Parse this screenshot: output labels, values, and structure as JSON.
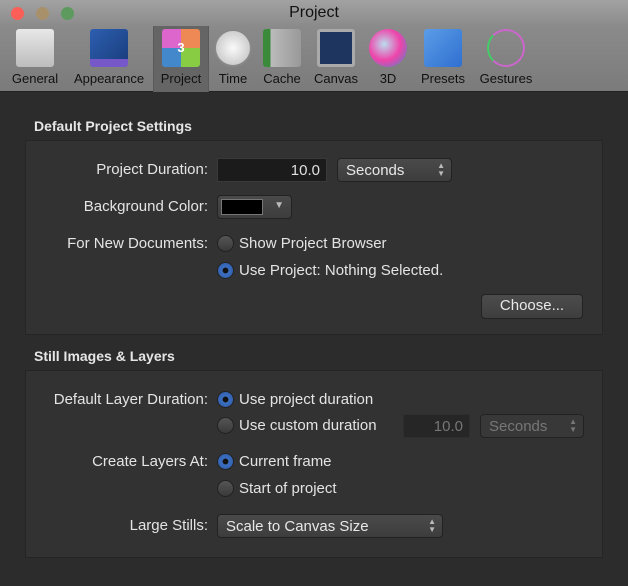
{
  "window": {
    "title": "Project"
  },
  "toolbar": [
    {
      "label": "General",
      "icon": "switch-icon"
    },
    {
      "label": "Appearance",
      "icon": "appearance-icon"
    },
    {
      "label": "Project",
      "icon": "project-countdown-icon"
    },
    {
      "label": "Time",
      "icon": "stopwatch-icon"
    },
    {
      "label": "Cache",
      "icon": "hard-drive-icon"
    },
    {
      "label": "Canvas",
      "icon": "canvas-icon"
    },
    {
      "label": "3D",
      "icon": "sphere-icon"
    },
    {
      "label": "Presets",
      "icon": "presets-icon"
    },
    {
      "label": "Gestures",
      "icon": "pen-icon"
    }
  ],
  "selected_tab": "Project",
  "defaults": {
    "heading": "Default Project Settings",
    "duration_label": "Project Duration:",
    "duration_value": "10.0",
    "duration_unit": "Seconds",
    "bg_label": "Background Color:",
    "bg_color": "#000000",
    "new_docs_label": "For New Documents:",
    "radio_browser": "Show Project Browser",
    "radio_use_project": "Use Project: Nothing Selected.",
    "choose_button": "Choose..."
  },
  "stills": {
    "heading": "Still Images & Layers",
    "layer_duration_label": "Default Layer Duration:",
    "radio_project_duration": "Use project duration",
    "radio_custom": "Use custom duration",
    "custom_value": "10.0",
    "custom_unit": "Seconds",
    "create_label": "Create Layers At:",
    "radio_current": "Current frame",
    "radio_start": "Start of project",
    "large_label": "Large Stills:",
    "large_value": "Scale to Canvas Size"
  }
}
